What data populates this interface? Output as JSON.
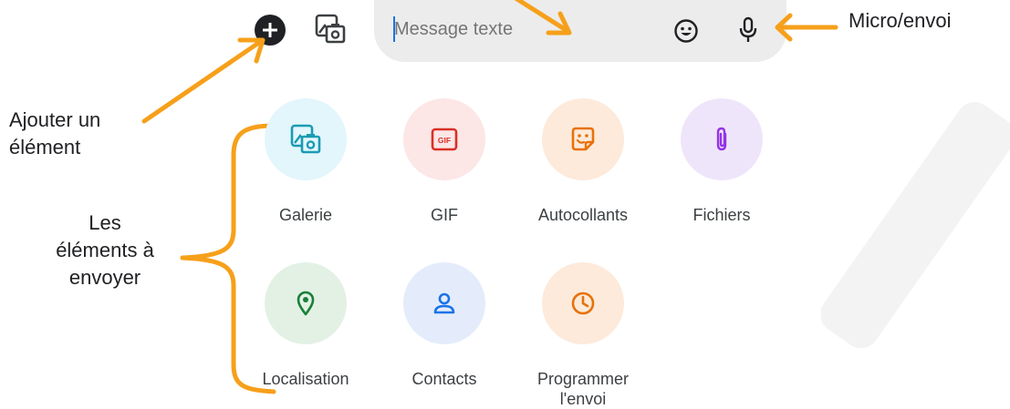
{
  "compose": {
    "placeholder": "Message texte",
    "add_icon": "plus-circle-icon",
    "gallery_icon": "gallery-icon",
    "emoji_icon": "emoji-icon",
    "mic_icon": "microphone-icon"
  },
  "annotations": {
    "add_element": "Ajouter un élément",
    "mic_send": "Micro/envoi",
    "items_line1": "Les",
    "items_line2": "éléments à",
    "items_line3": "envoyer"
  },
  "attachments": [
    {
      "label": "Galerie",
      "icon": "gallery-icon",
      "bg": "#e2f6fb",
      "fg": "#1a9bb3"
    },
    {
      "label": "GIF",
      "icon": "gif-icon",
      "bg": "#fce6e6",
      "fg": "#d93025"
    },
    {
      "label": "Autocollants",
      "icon": "sticker-icon",
      "bg": "#fdeadb",
      "fg": "#e8710a"
    },
    {
      "label": "Fichiers",
      "icon": "attachment-icon",
      "bg": "#efe5fb",
      "fg": "#9334e6"
    },
    {
      "label": "Localisation",
      "icon": "location-icon",
      "bg": "#e3f1e5",
      "fg": "#188038"
    },
    {
      "label": "Contacts",
      "icon": "contact-icon",
      "bg": "#e4ecfb",
      "fg": "#1a73e8"
    },
    {
      "label": "Programmer l'envoi",
      "icon": "clock-icon",
      "bg": "#fdeadb",
      "fg": "#e8710a"
    }
  ],
  "colors": {
    "accent": "#f6a01a",
    "bar": "#ececec"
  }
}
